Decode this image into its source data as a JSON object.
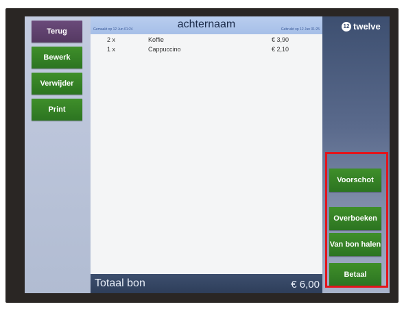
{
  "left_buttons": {
    "back": "Terug",
    "edit": "Bewerk",
    "delete": "Verwijder",
    "print": "Print"
  },
  "header": {
    "title": "achternaam",
    "created": "Gemaakt op 12 Jun 01:24",
    "modified": "Gebruikt op 12 Jun 01:25"
  },
  "order_lines": [
    {
      "qty": "2 x",
      "item": "Koffie",
      "price": "€ 3,90"
    },
    {
      "qty": "1 x",
      "item": "Cappuccino",
      "price": "€ 2,10"
    }
  ],
  "footer": {
    "label": "Totaal bon",
    "total": "€ 6,00"
  },
  "logo": {
    "mark": "12",
    "text": "twelve"
  },
  "right_buttons": {
    "advance": "Voorschot",
    "transfer": "Overboeken",
    "from_bill": "Van bon halen",
    "pay": "Betaal"
  },
  "colors": {
    "action_green": "#2f7a24",
    "back_purple": "#5e416c",
    "highlight_red": "#e3141b"
  }
}
